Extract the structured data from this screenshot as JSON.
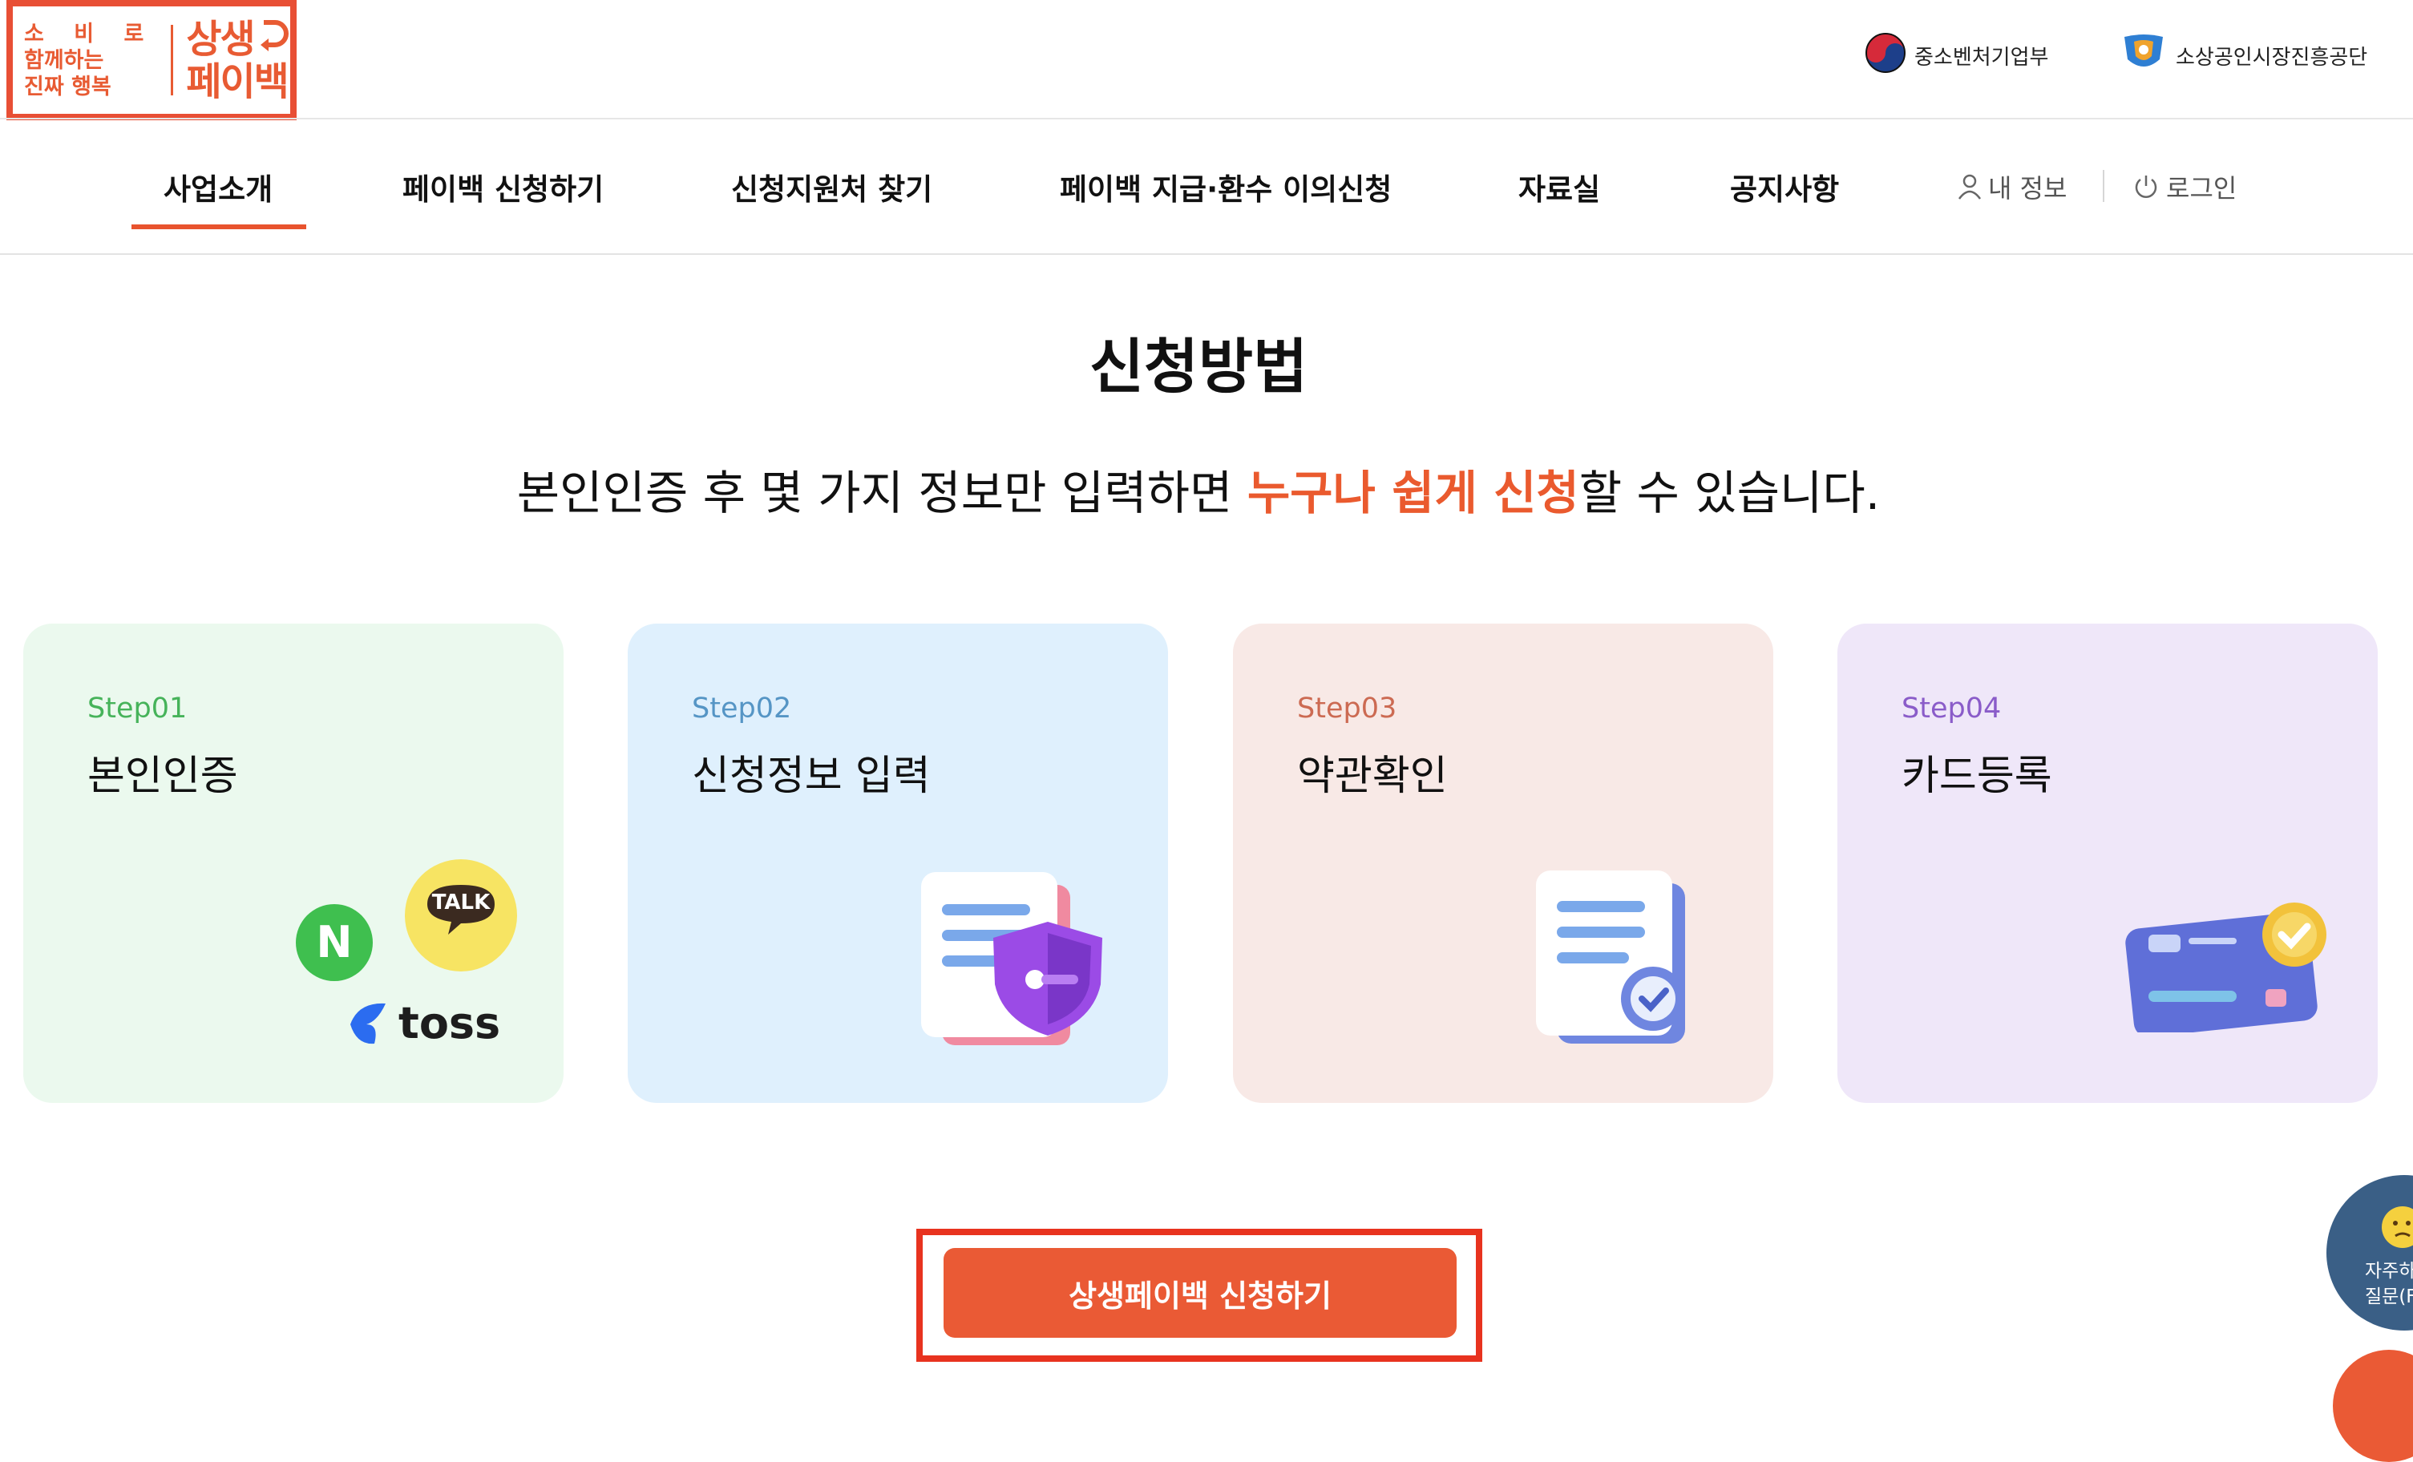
{
  "header": {
    "logo": {
      "tagline_line1": "소 비 로",
      "tagline_line2": "함께하는",
      "tagline_line3": "진짜 행복",
      "brand_line1": "상생",
      "brand_line2": "페이백",
      "color": "#e85b33"
    },
    "gov_links": [
      {
        "label": "중소벤처기업부",
        "icon": "korea-taegeuk-icon"
      },
      {
        "label": "소상공인시장진흥공단",
        "icon": "semas-logo-icon"
      }
    ]
  },
  "nav": {
    "items": [
      {
        "label": "사업소개",
        "active": true
      },
      {
        "label": "페이백 신청하기"
      },
      {
        "label": "신청지원처 찾기"
      },
      {
        "label": "페이백 지급·환수 이의신청"
      },
      {
        "label": "자료실"
      },
      {
        "label": "공지사항"
      }
    ],
    "my_info": "내 정보",
    "login": "로그인"
  },
  "section": {
    "title": "신청방법",
    "subtitle_prefix": "본인인증 후 몇 가지 정보만 입력하면 ",
    "subtitle_highlight": "누구나 쉽게 신청",
    "subtitle_suffix": "할 수 있습니다."
  },
  "steps": [
    {
      "step": "Step01",
      "title": "본인인증",
      "icons": [
        "naver-icon",
        "kakao-talk-icon",
        "toss-icon"
      ],
      "talk_label": "TALK",
      "naver_label": "N",
      "toss_label": "toss"
    },
    {
      "step": "Step02",
      "title": "신청정보 입력",
      "icon": "document-shield-icon"
    },
    {
      "step": "Step03",
      "title": "약관확인",
      "icon": "document-check-icon"
    },
    {
      "step": "Step04",
      "title": "카드등록",
      "icon": "card-check-icon"
    }
  ],
  "cta": {
    "label": "상생페이백 신청하기"
  },
  "faq": {
    "label": "자주하\n질문(F"
  },
  "colors": {
    "accent": "#ea5a35",
    "highlight_frame": "#e8331f",
    "step1_bg": "#ebf9ee",
    "step2_bg": "#dff0fd",
    "step3_bg": "#f8e9e6",
    "step4_bg": "#efe7f9"
  }
}
